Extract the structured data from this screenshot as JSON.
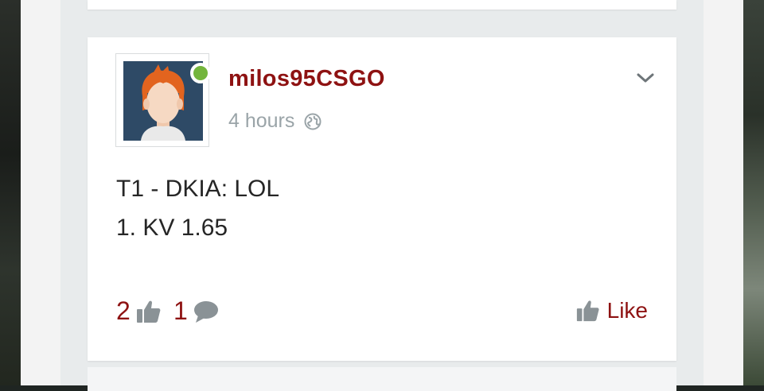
{
  "post": {
    "author": "milos95CSGO",
    "time": "4 hours",
    "visibility_icon": "globe-icon",
    "online_status": "online",
    "content": [
      "T1 - DKIA: LOL",
      "1. KV 1.65"
    ],
    "likes_count": "2",
    "comments_count": "1",
    "like_label": "Like"
  },
  "colors": {
    "accent": "#8e1212",
    "online": "#73b53c",
    "muted": "#9aa4a8"
  }
}
